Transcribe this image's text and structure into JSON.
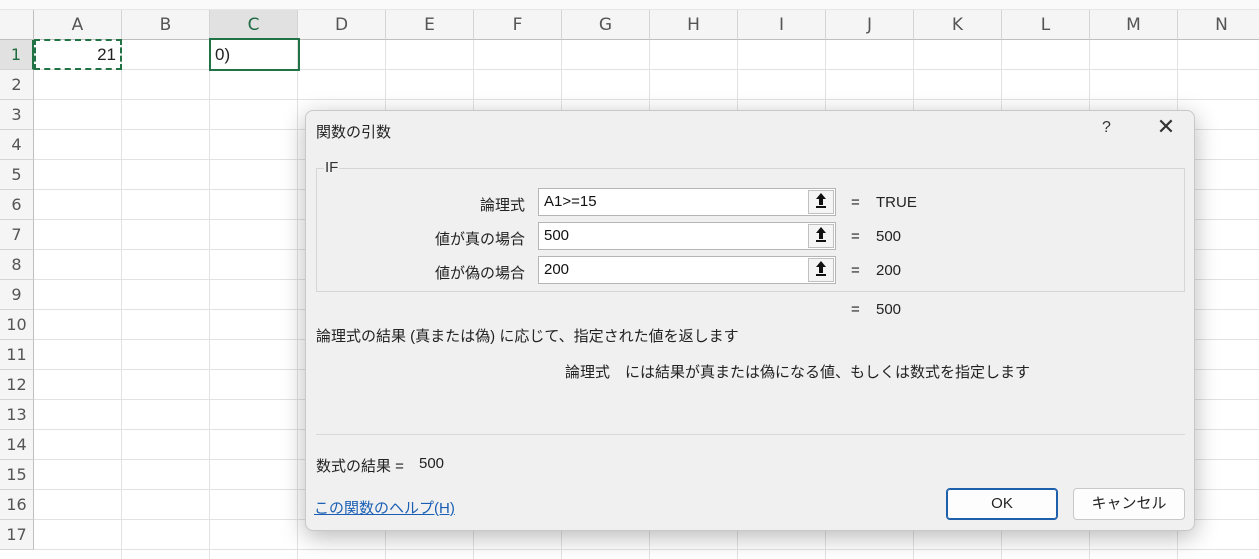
{
  "sheet": {
    "columns": [
      "A",
      "B",
      "C",
      "D",
      "E",
      "F",
      "G",
      "H",
      "I",
      "J",
      "K",
      "L",
      "M",
      "N"
    ],
    "rows": [
      "1",
      "2",
      "3",
      "4",
      "5",
      "6",
      "7",
      "8",
      "9",
      "10",
      "11",
      "12",
      "13",
      "14",
      "15",
      "16",
      "17"
    ],
    "cell_a1": "21",
    "cell_c1": "0)"
  },
  "dialog": {
    "title": "関数の引数",
    "help_glyph": "?",
    "close_glyph": "✕",
    "function_name": "IF",
    "args": [
      {
        "label": "論理式",
        "value": "A1>=15",
        "result": "TRUE"
      },
      {
        "label": "値が真の場合",
        "value": "500",
        "result": "500"
      },
      {
        "label": "値が偽の場合",
        "value": "200",
        "result": "200"
      }
    ],
    "equals": "=",
    "overall_result": "500",
    "description": "論理式の結果 (真または偽) に応じて、指定された値を返します",
    "arg_desc_name": "論理式",
    "arg_desc_text": "には結果が真または偽になる値、もしくは数式を指定します",
    "formula_result_label": "数式の結果 =",
    "formula_result_value": "500",
    "help_link": "この関数のヘルプ(H)",
    "ok_label": "OK",
    "cancel_label": "キャンセル",
    "icons": {
      "ref": "collapse-dialog-icon"
    }
  }
}
